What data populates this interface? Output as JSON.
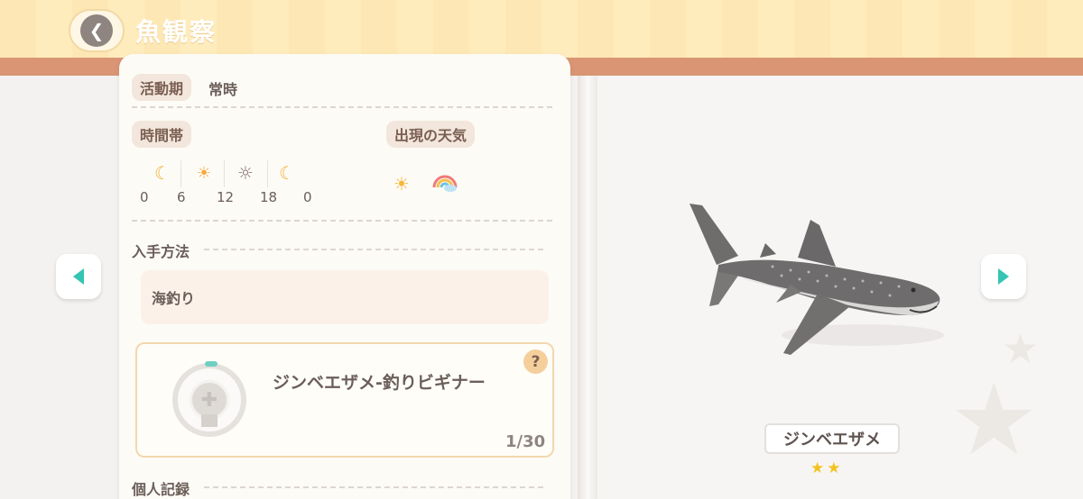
{
  "header": {
    "title": "魚観察",
    "back_icon": "back-arrow-icon"
  },
  "activity": {
    "label": "活動期",
    "value": "常時"
  },
  "time": {
    "label": "時間帯",
    "icons": [
      "moon-icon",
      "sunrise-icon",
      "sun-icon",
      "moon-icon"
    ],
    "ticks": [
      "0",
      "6",
      "12",
      "18",
      "0"
    ]
  },
  "weather": {
    "label": "出現の天気",
    "icons": [
      "sunny-icon",
      "rainbow-icon"
    ]
  },
  "obtain": {
    "label": "入手方法",
    "value": "海釣り"
  },
  "achievement": {
    "title": "ジンベエザメ-釣りビギナー",
    "count": "1/30",
    "help": "?",
    "progress": 0.033
  },
  "record": {
    "label": "個人記録"
  },
  "fish": {
    "name": "ジンベエザメ",
    "stars": 2
  },
  "colors": {
    "accent": "#34c5b3",
    "header": "#fde7b4",
    "stripe": "#d99574"
  }
}
